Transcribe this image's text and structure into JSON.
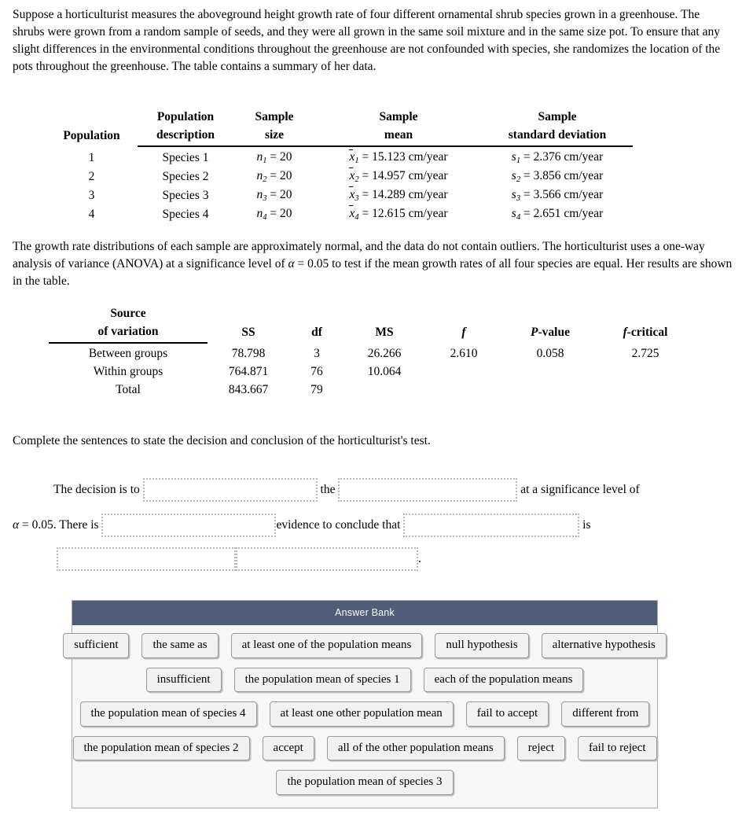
{
  "intro": {
    "text": "Suppose a horticulturist measures the aboveground height growth rate of four different ornamental shrub species grown in a greenhouse. The shrubs were grown from a random sample of seeds, and they were all grown in the same soil mixture and in the same size pot. To ensure that any slight differences in the environmental conditions throughout the greenhouse are not confounded with species, she randomizes the location of the pots throughout the greenhouse. The table contains a summary of her data."
  },
  "summary_table": {
    "headers": {
      "population": "Population",
      "description_line1": "Population",
      "description_line2": "description",
      "size_line1": "Sample",
      "size_line2": "size",
      "mean_line1": "Sample",
      "mean_line2": "mean",
      "sd_line1": "Sample",
      "sd_line2": "standard deviation"
    },
    "rows": [
      {
        "population": "1",
        "description": "Species 1",
        "n_symbol": "n",
        "n_sub": "1",
        "n_eq": "=",
        "n_value": "20",
        "mean_symbol": "x",
        "mean_sub": "1",
        "mean_eq": "=",
        "mean_value": "15.123 cm/year",
        "sd_symbol": "s",
        "sd_sub": "1",
        "sd_eq": "=",
        "sd_value": "2.376 cm/year"
      },
      {
        "population": "2",
        "description": "Species 2",
        "n_symbol": "n",
        "n_sub": "2",
        "n_eq": "=",
        "n_value": "20",
        "mean_symbol": "x",
        "mean_sub": "2",
        "mean_eq": "=",
        "mean_value": "14.957 cm/year",
        "sd_symbol": "s",
        "sd_sub": "2",
        "sd_eq": "=",
        "sd_value": "3.856 cm/year"
      },
      {
        "population": "3",
        "description": "Species 3",
        "n_symbol": "n",
        "n_sub": "3",
        "n_eq": "=",
        "n_value": "20",
        "mean_symbol": "x",
        "mean_sub": "3",
        "mean_eq": "=",
        "mean_value": "14.289 cm/year",
        "sd_symbol": "s",
        "sd_sub": "3",
        "sd_eq": "=",
        "sd_value": "3.566 cm/year"
      },
      {
        "population": "4",
        "description": "Species 4",
        "n_symbol": "n",
        "n_sub": "4",
        "n_eq": "=",
        "n_value": "20",
        "mean_symbol": "x",
        "mean_sub": "4",
        "mean_eq": "=",
        "mean_value": "12.615 cm/year",
        "sd_symbol": "s",
        "sd_sub": "4",
        "sd_eq": "=",
        "sd_value": "2.651 cm/year"
      }
    ]
  },
  "anova_paragraph": {
    "part1": "The growth rate distributions of each sample are approximately normal, and the data do not contain outliers. The horticulturist uses a one-way analysis of variance (ANOVA) at a significance level of ",
    "alpha": "α",
    "part2": " = 0.05 to test if the mean growth rates of all four species are equal. Her results are shown in the table."
  },
  "anova_table": {
    "headers": {
      "source_line1": "Source",
      "source_line2": "of variation",
      "ss": "SS",
      "df": "df",
      "ms": "MS",
      "f": "f",
      "p_prefix": "P",
      "p_suffix": "-value",
      "fcrit_prefix": "f",
      "fcrit_suffix": "-critical"
    },
    "rows": [
      {
        "source": "Between groups",
        "ss": "78.798",
        "df": "3",
        "ms": "26.266",
        "f": "2.610",
        "p": "0.058",
        "fcrit": "2.725"
      },
      {
        "source": "Within groups",
        "ss": "764.871",
        "df": "76",
        "ms": "10.064",
        "f": "",
        "p": "",
        "fcrit": ""
      },
      {
        "source": "Total",
        "ss": "843.667",
        "df": "79",
        "ms": "",
        "f": "",
        "p": "",
        "fcrit": ""
      }
    ]
  },
  "instruction": {
    "text": "Complete the sentences to state the decision and conclusion of the horticulturist's test."
  },
  "sentences": {
    "row1": {
      "lead": "The decision is to ",
      "between": " the ",
      "trail": " at a significance level of"
    },
    "row2": {
      "alpha": "α",
      "lead_after_alpha": " = 0.05. There is ",
      "between": "evidence to conclude that ",
      "trail": " is"
    },
    "row3": {
      "period": "."
    },
    "blank_placeholder": ""
  },
  "answer_bank": {
    "title": "Answer Bank",
    "rows": [
      [
        "sufficient",
        "the same as",
        "at least one of the population means",
        "null hypothesis",
        "alternative hypothesis"
      ],
      [
        "insufficient",
        "the population mean of species 1",
        "each of the population means"
      ],
      [
        "the population mean of species 4",
        "at least one other population mean",
        "fail to accept",
        "different from"
      ],
      [
        "the population mean of species 2",
        "accept",
        "all of the other population means",
        "reject",
        "fail to reject"
      ],
      [
        "the population mean of species 3"
      ]
    ]
  },
  "colors": {
    "bank_header": "#4f5d78",
    "bank_background": "#f7f7f7",
    "tile_border": "#9a9a9a",
    "blank_border": "#b8b8b8"
  }
}
